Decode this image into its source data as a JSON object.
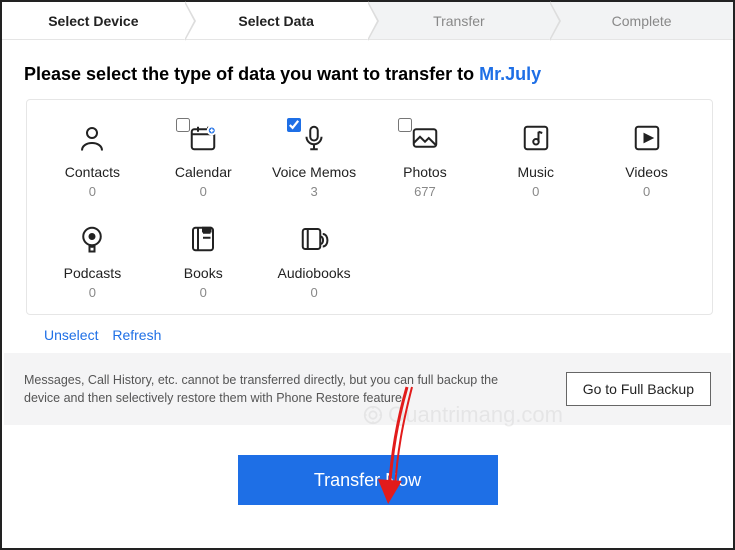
{
  "steps": {
    "selectDevice": "Select Device",
    "selectData": "Select Data",
    "transfer": "Transfer",
    "complete": "Complete",
    "activeIndex": 1
  },
  "prompt": {
    "prefix": "Please select the type of data you want to transfer to ",
    "device": "Mr.July"
  },
  "types": {
    "contacts": {
      "label": "Contacts",
      "count": "0",
      "checked": false
    },
    "calendar": {
      "label": "Calendar",
      "count": "0",
      "checked": false,
      "checkboxShown": true
    },
    "voicememos": {
      "label": "Voice Memos",
      "count": "3",
      "checked": true,
      "checkboxShown": true
    },
    "photos": {
      "label": "Photos",
      "count": "677",
      "checked": false,
      "checkboxShown": true
    },
    "music": {
      "label": "Music",
      "count": "0",
      "checked": false
    },
    "videos": {
      "label": "Videos",
      "count": "0",
      "checked": false
    },
    "podcasts": {
      "label": "Podcasts",
      "count": "0",
      "checked": false
    },
    "books": {
      "label": "Books",
      "count": "0",
      "checked": false
    },
    "audiobooks": {
      "label": "Audiobooks",
      "count": "0",
      "checked": false
    }
  },
  "links": {
    "unselect": "Unselect",
    "refresh": "Refresh"
  },
  "notice": {
    "text": "Messages, Call History, etc. cannot be transferred directly, but you can full backup the device and then selectively restore them with Phone Restore feature.",
    "button": "Go to Full Backup"
  },
  "primaryButton": "Transfer Now",
  "watermark": "Quantrimang.com",
  "colors": {
    "accent": "#1e6fe6",
    "arrow": "#e21b1b"
  }
}
